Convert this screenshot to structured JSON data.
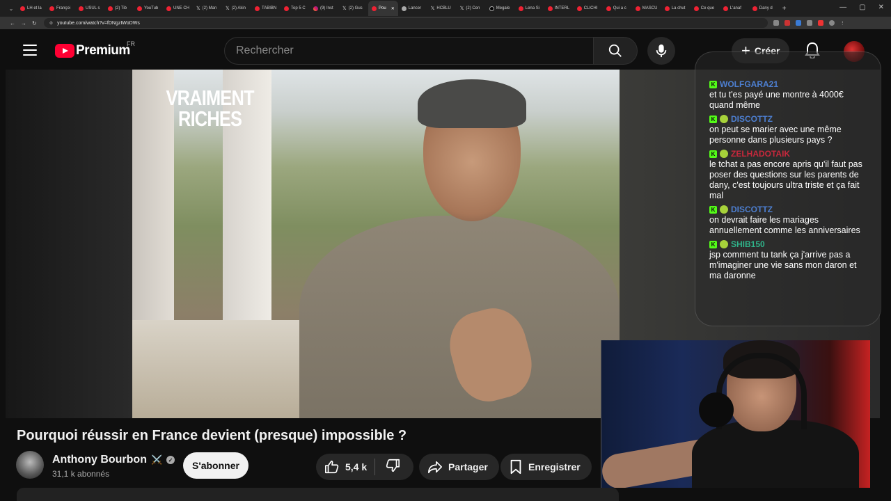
{
  "browser": {
    "tabs": [
      {
        "label": "LH et la",
        "icon": "red"
      },
      {
        "label": "Françoi",
        "icon": "red"
      },
      {
        "label": "USUL s",
        "icon": "red"
      },
      {
        "label": "(2) Tib",
        "icon": "red"
      },
      {
        "label": "YouTub",
        "icon": "red"
      },
      {
        "label": "UNE CH",
        "icon": "red"
      },
      {
        "label": "(2) Man",
        "icon": "x"
      },
      {
        "label": "(2) Akin",
        "icon": "x"
      },
      {
        "label": "TABIBN",
        "icon": "red"
      },
      {
        "label": "Top 5 C",
        "icon": "red"
      },
      {
        "label": "(9) Inst",
        "icon": "ig"
      },
      {
        "label": "(2) Gus",
        "icon": "x"
      },
      {
        "label": "Pou",
        "icon": "red",
        "active": true
      },
      {
        "label": "Lancer",
        "icon": "gray"
      },
      {
        "label": "HCBLU",
        "icon": "x"
      },
      {
        "label": "(2) Cen",
        "icon": "x"
      },
      {
        "label": "Megale",
        "icon": "black"
      },
      {
        "label": "Lena Si",
        "icon": "red"
      },
      {
        "label": "INTERL",
        "icon": "red"
      },
      {
        "label": "CLICHI",
        "icon": "red"
      },
      {
        "label": "Qui a c",
        "icon": "red"
      },
      {
        "label": "MASCU",
        "icon": "red"
      },
      {
        "label": "La chut",
        "icon": "red"
      },
      {
        "label": "Ce que",
        "icon": "red"
      },
      {
        "label": "L'anaf",
        "icon": "red"
      },
      {
        "label": "Dany d",
        "icon": "red"
      }
    ],
    "url": "youtube.com/watch?v=fDNgzIWoDWs"
  },
  "header": {
    "logo_text": "Premium",
    "logo_region": "FR",
    "search_placeholder": "Rechercher",
    "create_label": "Créer"
  },
  "video": {
    "overlay_title": "VRAIMENT RICHES",
    "title": "Pourquoi réussir en France devient (presque) impossible ?"
  },
  "channel": {
    "name": "Anthony Bourbon",
    "name_emoji": "⚔️",
    "subscribers": "31,1 k abonnés",
    "subscribe_label": "S'abonner"
  },
  "actions": {
    "likes": "5,4 k",
    "share_label": "Partager",
    "save_label": "Enregistrer"
  },
  "chat": {
    "messages": [
      {
        "user": "WOLFGARA21",
        "color": "#4d7fd1",
        "badges": [
          "k"
        ],
        "text": "et tu t'es payé une montre à 4000€ quand même"
      },
      {
        "user": "DISCOTTZ",
        "color": "#4d7fd1",
        "badges": [
          "k",
          "g"
        ],
        "text": "on peut se marier avec une même personne dans plusieurs pays ?"
      },
      {
        "user": "ZELHADOTAIK",
        "color": "#c8283c",
        "badges": [
          "k",
          "g"
        ],
        "text": "le tchat a pas encore apris qu'il faut pas poser des questions sur les parents de dany, c'est toujours ultra triste et ça fait mal"
      },
      {
        "user": "DISCOTTZ",
        "color": "#4d7fd1",
        "badges": [
          "k",
          "g"
        ],
        "text": "on devrait faire les mariages annuellement comme les anniversaires"
      },
      {
        "user": "SHIB150",
        "color": "#2fb48a",
        "badges": [
          "k",
          "g"
        ],
        "text": "jsp comment tu tank ça j'arrive pas a m'imaginer une vie sans mon daron et ma daronne"
      }
    ]
  },
  "colors": {
    "yt_red": "#ff0033",
    "kick_green": "#53fc18",
    "background": "#0f0f0f"
  }
}
